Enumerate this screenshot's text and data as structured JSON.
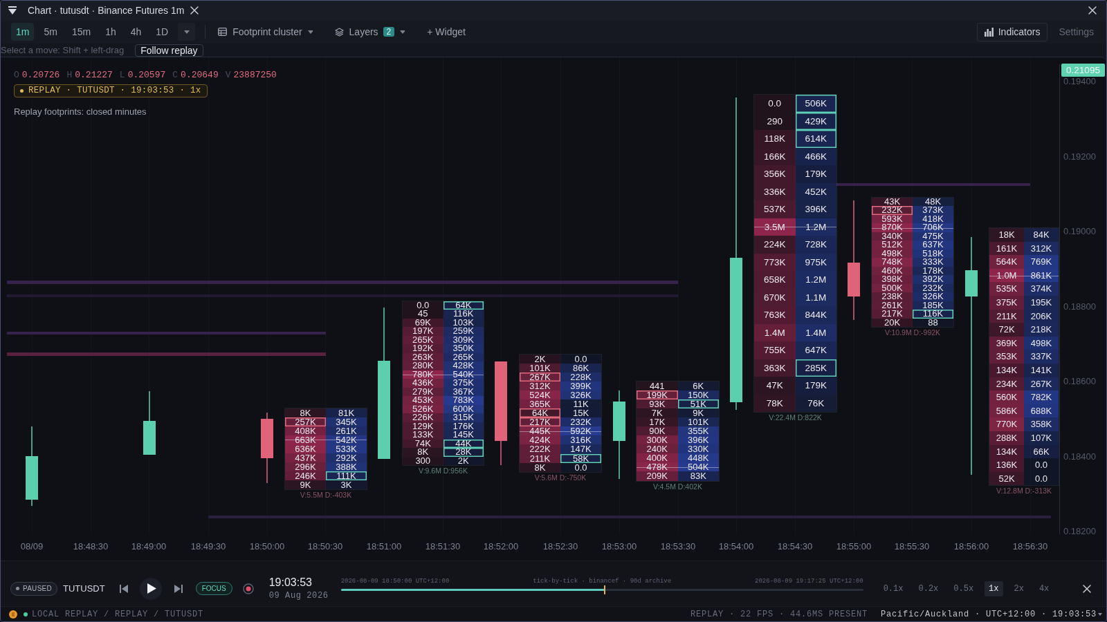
{
  "window": {
    "title": "Chart · tutusdt · Binance Futures 1m"
  },
  "timeframes": [
    {
      "label": "1m",
      "selected": true
    },
    {
      "label": "5m",
      "selected": false
    },
    {
      "label": "15m",
      "selected": false
    },
    {
      "label": "1h",
      "selected": false
    },
    {
      "label": "4h",
      "selected": false
    },
    {
      "label": "1D",
      "selected": false
    }
  ],
  "toolbar": {
    "chart_type": "Footprint cluster",
    "layers": "Layers",
    "layer_count": "2",
    "widget": "+ Widget",
    "indicators": "Indicators",
    "settings": "Settings"
  },
  "hint": {
    "text": "Select a move: Shift + left-drag",
    "follow_button": "Follow replay"
  },
  "chart": {
    "ohlc": [
      {
        "label": "O",
        "value": "0.20726"
      },
      {
        "label": "H",
        "value": "0.21227"
      },
      {
        "label": "L",
        "value": "0.20597"
      },
      {
        "label": "C",
        "value": "0.20649"
      },
      {
        "label": "V",
        "value": "23887250"
      }
    ],
    "replay_badge": "REPLAY · TUTUSDT · 19:03:53 · 1x",
    "note": "Replay footprints: closed minutes",
    "last_price": "0.21095",
    "price_labels": [
      "0.19400",
      "0.19200",
      "0.19000",
      "0.18800",
      "0.18600",
      "0.18400",
      "0.18200"
    ],
    "time_labels": [
      "08/09",
      "18:48:30",
      "18:49:00",
      "18:49:30",
      "18:50:00",
      "18:50:30",
      "18:51:00",
      "18:51:30",
      "18:52:00",
      "18:52:30",
      "18:53:00",
      "18:53:30",
      "18:54:00",
      "18:54:30",
      "18:55:00",
      "18:55:30",
      "18:56:00",
      "18:56:30"
    ],
    "zones": [
      {
        "color": "#35234c"
      },
      {
        "color": "#211a30"
      },
      {
        "color": "#35234c"
      },
      {
        "color": "#58223f"
      },
      {
        "color": "#35234c"
      },
      {
        "color": "#2a1f3e"
      }
    ],
    "candles": [
      {
        "kind": "plain",
        "bullish": true
      },
      {
        "kind": "plain",
        "bullish": true
      },
      {
        "kind": "footprint",
        "bullish": false,
        "summary": "V:5.5M D:-403K",
        "negative_delta": true,
        "rows": [
          {
            "bid": "8K",
            "ask": "81K",
            "bid_highlight": false,
            "ask_highlight": false,
            "poc": false
          },
          {
            "bid": "257K",
            "ask": "345K",
            "bid_highlight": true,
            "ask_highlight": false,
            "poc": false
          },
          {
            "bid": "408K",
            "ask": "261K",
            "bid_highlight": false,
            "ask_highlight": false,
            "poc": false
          },
          {
            "bid": "663K",
            "ask": "542K",
            "bid_highlight": false,
            "ask_highlight": false,
            "poc": true
          },
          {
            "bid": "636K",
            "ask": "533K",
            "bid_highlight": false,
            "ask_highlight": false,
            "poc": false
          },
          {
            "bid": "437K",
            "ask": "292K",
            "bid_highlight": false,
            "ask_highlight": false,
            "poc": false
          },
          {
            "bid": "296K",
            "ask": "388K",
            "bid_highlight": false,
            "ask_highlight": false,
            "poc": false
          },
          {
            "bid": "246K",
            "ask": "111K",
            "bid_highlight": false,
            "ask_highlight": true,
            "poc": false
          },
          {
            "bid": "9K",
            "ask": "3K",
            "bid_highlight": false,
            "ask_highlight": false,
            "poc": false
          }
        ]
      },
      {
        "kind": "footprint",
        "bullish": true,
        "summary": "V:9.6M D:956K",
        "negative_delta": false,
        "rows": [
          {
            "bid": "0.0",
            "ask": "64K",
            "bid_highlight": false,
            "ask_highlight": true,
            "poc": false
          },
          {
            "bid": "45",
            "ask": "116K",
            "bid_highlight": false,
            "ask_highlight": false,
            "poc": false
          },
          {
            "bid": "69K",
            "ask": "103K",
            "bid_highlight": false,
            "ask_highlight": false,
            "poc": false
          },
          {
            "bid": "197K",
            "ask": "259K",
            "bid_highlight": false,
            "ask_highlight": false,
            "poc": false
          },
          {
            "bid": "265K",
            "ask": "309K",
            "bid_highlight": false,
            "ask_highlight": false,
            "poc": false
          },
          {
            "bid": "192K",
            "ask": "350K",
            "bid_highlight": false,
            "ask_highlight": false,
            "poc": false
          },
          {
            "bid": "263K",
            "ask": "265K",
            "bid_highlight": false,
            "ask_highlight": false,
            "poc": false
          },
          {
            "bid": "280K",
            "ask": "428K",
            "bid_highlight": false,
            "ask_highlight": false,
            "poc": false
          },
          {
            "bid": "780K",
            "ask": "540K",
            "bid_highlight": false,
            "ask_highlight": false,
            "poc": true
          },
          {
            "bid": "436K",
            "ask": "375K",
            "bid_highlight": false,
            "ask_highlight": false,
            "poc": false
          },
          {
            "bid": "279K",
            "ask": "367K",
            "bid_highlight": false,
            "ask_highlight": false,
            "poc": false
          },
          {
            "bid": "453K",
            "ask": "783K",
            "bid_highlight": false,
            "ask_highlight": false,
            "poc": false
          },
          {
            "bid": "526K",
            "ask": "600K",
            "bid_highlight": false,
            "ask_highlight": false,
            "poc": false
          },
          {
            "bid": "226K",
            "ask": "315K",
            "bid_highlight": false,
            "ask_highlight": false,
            "poc": false
          },
          {
            "bid": "129K",
            "ask": "176K",
            "bid_highlight": false,
            "ask_highlight": false,
            "poc": false
          },
          {
            "bid": "133K",
            "ask": "145K",
            "bid_highlight": false,
            "ask_highlight": false,
            "poc": false
          },
          {
            "bid": "74K",
            "ask": "44K",
            "bid_highlight": false,
            "ask_highlight": true,
            "poc": false
          },
          {
            "bid": "8K",
            "ask": "28K",
            "bid_highlight": false,
            "ask_highlight": true,
            "poc": false
          },
          {
            "bid": "300",
            "ask": "2K",
            "bid_highlight": false,
            "ask_highlight": false,
            "poc": false
          }
        ]
      },
      {
        "kind": "footprint",
        "bullish": false,
        "summary": "V:5.6M D:-750K",
        "negative_delta": true,
        "rows": [
          {
            "bid": "2K",
            "ask": "0.0",
            "bid_highlight": false,
            "ask_highlight": false,
            "poc": false
          },
          {
            "bid": "101K",
            "ask": "86K",
            "bid_highlight": false,
            "ask_highlight": false,
            "poc": false
          },
          {
            "bid": "267K",
            "ask": "228K",
            "bid_highlight": true,
            "ask_highlight": false,
            "poc": false
          },
          {
            "bid": "312K",
            "ask": "399K",
            "bid_highlight": false,
            "ask_highlight": false,
            "poc": false
          },
          {
            "bid": "524K",
            "ask": "326K",
            "bid_highlight": false,
            "ask_highlight": false,
            "poc": false
          },
          {
            "bid": "365K",
            "ask": "11K",
            "bid_highlight": false,
            "ask_highlight": false,
            "poc": false
          },
          {
            "bid": "64K",
            "ask": "15K",
            "bid_highlight": true,
            "ask_highlight": false,
            "poc": false
          },
          {
            "bid": "217K",
            "ask": "232K",
            "bid_highlight": true,
            "ask_highlight": false,
            "poc": false
          },
          {
            "bid": "445K",
            "ask": "592K",
            "bid_highlight": false,
            "ask_highlight": false,
            "poc": true
          },
          {
            "bid": "424K",
            "ask": "316K",
            "bid_highlight": false,
            "ask_highlight": false,
            "poc": false
          },
          {
            "bid": "222K",
            "ask": "147K",
            "bid_highlight": false,
            "ask_highlight": false,
            "poc": false
          },
          {
            "bid": "211K",
            "ask": "58K",
            "bid_highlight": false,
            "ask_highlight": true,
            "poc": false
          },
          {
            "bid": "8K",
            "ask": "0.0",
            "bid_highlight": false,
            "ask_highlight": false,
            "poc": false
          }
        ]
      },
      {
        "kind": "footprint",
        "bullish": true,
        "summary": "V:4.5M D:402K",
        "negative_delta": false,
        "rows": [
          {
            "bid": "441",
            "ask": "6K",
            "bid_highlight": false,
            "ask_highlight": false,
            "poc": false
          },
          {
            "bid": "199K",
            "ask": "150K",
            "bid_highlight": true,
            "ask_highlight": false,
            "poc": false
          },
          {
            "bid": "93K",
            "ask": "51K",
            "bid_highlight": false,
            "ask_highlight": true,
            "poc": false
          },
          {
            "bid": "7K",
            "ask": "9K",
            "bid_highlight": false,
            "ask_highlight": false,
            "poc": false
          },
          {
            "bid": "17K",
            "ask": "101K",
            "bid_highlight": false,
            "ask_highlight": false,
            "poc": false
          },
          {
            "bid": "90K",
            "ask": "355K",
            "bid_highlight": false,
            "ask_highlight": false,
            "poc": false
          },
          {
            "bid": "300K",
            "ask": "396K",
            "bid_highlight": false,
            "ask_highlight": false,
            "poc": false
          },
          {
            "bid": "240K",
            "ask": "330K",
            "bid_highlight": false,
            "ask_highlight": false,
            "poc": false
          },
          {
            "bid": "400K",
            "ask": "448K",
            "bid_highlight": false,
            "ask_highlight": false,
            "poc": false
          },
          {
            "bid": "478K",
            "ask": "504K",
            "bid_highlight": false,
            "ask_highlight": false,
            "poc": true
          },
          {
            "bid": "209K",
            "ask": "83K",
            "bid_highlight": false,
            "ask_highlight": false,
            "poc": false
          }
        ]
      },
      {
        "kind": "footprint",
        "bullish": true,
        "summary": "V:22.4M D:822K",
        "negative_delta": false,
        "rows": [
          {
            "bid": "0.0",
            "ask": "506K",
            "bid_highlight": false,
            "ask_highlight": true,
            "poc": false
          },
          {
            "bid": "290",
            "ask": "429K",
            "bid_highlight": false,
            "ask_highlight": true,
            "poc": false
          },
          {
            "bid": "118K",
            "ask": "614K",
            "bid_highlight": false,
            "ask_highlight": true,
            "poc": false
          },
          {
            "bid": "166K",
            "ask": "466K",
            "bid_highlight": false,
            "ask_highlight": false,
            "poc": false
          },
          {
            "bid": "356K",
            "ask": "179K",
            "bid_highlight": false,
            "ask_highlight": false,
            "poc": false
          },
          {
            "bid": "336K",
            "ask": "452K",
            "bid_highlight": false,
            "ask_highlight": false,
            "poc": false
          },
          {
            "bid": "537K",
            "ask": "396K",
            "bid_highlight": false,
            "ask_highlight": false,
            "poc": false
          },
          {
            "bid": "3.5M",
            "ask": "1.2M",
            "bid_highlight": false,
            "ask_highlight": false,
            "poc": true
          },
          {
            "bid": "224K",
            "ask": "728K",
            "bid_highlight": false,
            "ask_highlight": false,
            "poc": false
          },
          {
            "bid": "773K",
            "ask": "975K",
            "bid_highlight": false,
            "ask_highlight": false,
            "poc": false
          },
          {
            "bid": "658K",
            "ask": "1.2M",
            "bid_highlight": false,
            "ask_highlight": false,
            "poc": false
          },
          {
            "bid": "670K",
            "ask": "1.1M",
            "bid_highlight": false,
            "ask_highlight": false,
            "poc": false
          },
          {
            "bid": "763K",
            "ask": "844K",
            "bid_highlight": false,
            "ask_highlight": false,
            "poc": false
          },
          {
            "bid": "1.4M",
            "ask": "1.4M",
            "bid_highlight": false,
            "ask_highlight": false,
            "poc": false
          },
          {
            "bid": "755K",
            "ask": "647K",
            "bid_highlight": false,
            "ask_highlight": false,
            "poc": false
          },
          {
            "bid": "363K",
            "ask": "285K",
            "bid_highlight": false,
            "ask_highlight": true,
            "poc": false
          },
          {
            "bid": "47K",
            "ask": "179K",
            "bid_highlight": false,
            "ask_highlight": false,
            "poc": false
          },
          {
            "bid": "78K",
            "ask": "76K",
            "bid_highlight": false,
            "ask_highlight": false,
            "poc": false
          }
        ]
      },
      {
        "kind": "footprint",
        "bullish": false,
        "summary": "V:10.9M D:-992K",
        "negative_delta": true,
        "rows": [
          {
            "bid": "43K",
            "ask": "48K",
            "bid_highlight": false,
            "ask_highlight": false,
            "poc": false
          },
          {
            "bid": "232K",
            "ask": "373K",
            "bid_highlight": true,
            "ask_highlight": false,
            "poc": false
          },
          {
            "bid": "593K",
            "ask": "418K",
            "bid_highlight": false,
            "ask_highlight": false,
            "poc": false
          },
          {
            "bid": "870K",
            "ask": "706K",
            "bid_highlight": false,
            "ask_highlight": false,
            "poc": true
          },
          {
            "bid": "340K",
            "ask": "475K",
            "bid_highlight": false,
            "ask_highlight": false,
            "poc": false
          },
          {
            "bid": "512K",
            "ask": "637K",
            "bid_highlight": false,
            "ask_highlight": false,
            "poc": false
          },
          {
            "bid": "498K",
            "ask": "518K",
            "bid_highlight": false,
            "ask_highlight": false,
            "poc": false
          },
          {
            "bid": "748K",
            "ask": "333K",
            "bid_highlight": false,
            "ask_highlight": false,
            "poc": false
          },
          {
            "bid": "460K",
            "ask": "178K",
            "bid_highlight": false,
            "ask_highlight": false,
            "poc": false
          },
          {
            "bid": "398K",
            "ask": "392K",
            "bid_highlight": false,
            "ask_highlight": false,
            "poc": false
          },
          {
            "bid": "500K",
            "ask": "232K",
            "bid_highlight": false,
            "ask_highlight": false,
            "poc": false
          },
          {
            "bid": "238K",
            "ask": "326K",
            "bid_highlight": false,
            "ask_highlight": false,
            "poc": false
          },
          {
            "bid": "261K",
            "ask": "185K",
            "bid_highlight": false,
            "ask_highlight": false,
            "poc": false
          },
          {
            "bid": "217K",
            "ask": "116K",
            "bid_highlight": false,
            "ask_highlight": true,
            "poc": false
          },
          {
            "bid": "20K",
            "ask": "88",
            "bid_highlight": false,
            "ask_highlight": false,
            "poc": false
          }
        ]
      },
      {
        "kind": "footprint",
        "bullish": true,
        "summary": "V:12.8M D:-313K",
        "negative_delta": true,
        "rows": [
          {
            "bid": "18K",
            "ask": "84K",
            "bid_highlight": false,
            "ask_highlight": false,
            "poc": false
          },
          {
            "bid": "161K",
            "ask": "312K",
            "bid_highlight": false,
            "ask_highlight": false,
            "poc": false
          },
          {
            "bid": "564K",
            "ask": "769K",
            "bid_highlight": false,
            "ask_highlight": false,
            "poc": false
          },
          {
            "bid": "1.0M",
            "ask": "861K",
            "bid_highlight": false,
            "ask_highlight": false,
            "poc": true
          },
          {
            "bid": "535K",
            "ask": "374K",
            "bid_highlight": false,
            "ask_highlight": false,
            "poc": false
          },
          {
            "bid": "375K",
            "ask": "195K",
            "bid_highlight": false,
            "ask_highlight": false,
            "poc": false
          },
          {
            "bid": "211K",
            "ask": "206K",
            "bid_highlight": false,
            "ask_highlight": false,
            "poc": false
          },
          {
            "bid": "72K",
            "ask": "218K",
            "bid_highlight": false,
            "ask_highlight": false,
            "poc": false
          },
          {
            "bid": "369K",
            "ask": "498K",
            "bid_highlight": false,
            "ask_highlight": false,
            "poc": false
          },
          {
            "bid": "353K",
            "ask": "337K",
            "bid_highlight": false,
            "ask_highlight": false,
            "poc": false
          },
          {
            "bid": "134K",
            "ask": "141K",
            "bid_highlight": false,
            "ask_highlight": false,
            "poc": false
          },
          {
            "bid": "234K",
            "ask": "267K",
            "bid_highlight": false,
            "ask_highlight": false,
            "poc": false
          },
          {
            "bid": "560K",
            "ask": "782K",
            "bid_highlight": false,
            "ask_highlight": false,
            "poc": false
          },
          {
            "bid": "586K",
            "ask": "688K",
            "bid_highlight": false,
            "ask_highlight": false,
            "poc": false
          },
          {
            "bid": "770K",
            "ask": "358K",
            "bid_highlight": false,
            "ask_highlight": false,
            "poc": false
          },
          {
            "bid": "288K",
            "ask": "107K",
            "bid_highlight": false,
            "ask_highlight": false,
            "poc": false
          },
          {
            "bid": "134K",
            "ask": "66K",
            "bid_highlight": false,
            "ask_highlight": false,
            "poc": false
          },
          {
            "bid": "136K",
            "ask": "0.0",
            "bid_highlight": false,
            "ask_highlight": false,
            "poc": false
          },
          {
            "bid": "52K",
            "ask": "0.0",
            "bid_highlight": false,
            "ask_highlight": false,
            "poc": false
          }
        ]
      }
    ]
  },
  "playback": {
    "state": "PAUSED",
    "symbol": "TUTUSDT",
    "focus": "FOCUS",
    "time": "19:03:53",
    "date": "09 Aug 2026",
    "timeline": {
      "start": "2026-08-09 18:50:00 UTC+12:00",
      "source": "tick-by-tick · binancef · 90d archive",
      "end": "2026-08-09 19:17:25 UTC+12:00",
      "level": 0.505
    },
    "speeds": [
      {
        "label": "0.1x",
        "selected": false
      },
      {
        "label": "0.2x",
        "selected": false
      },
      {
        "label": "0.5x",
        "selected": false
      },
      {
        "label": "1x",
        "selected": true
      },
      {
        "label": "2x",
        "selected": false
      },
      {
        "label": "4x",
        "selected": false
      }
    ]
  },
  "status_bar": {
    "path": "LOCAL REPLAY / REPLAY / TUTUSDT",
    "stats": "REPLAY · 22 FPS · 44.6MS PRESENT",
    "clock": "Pacific/Auckland · UTC+12:00 · 19:03:53"
  }
}
